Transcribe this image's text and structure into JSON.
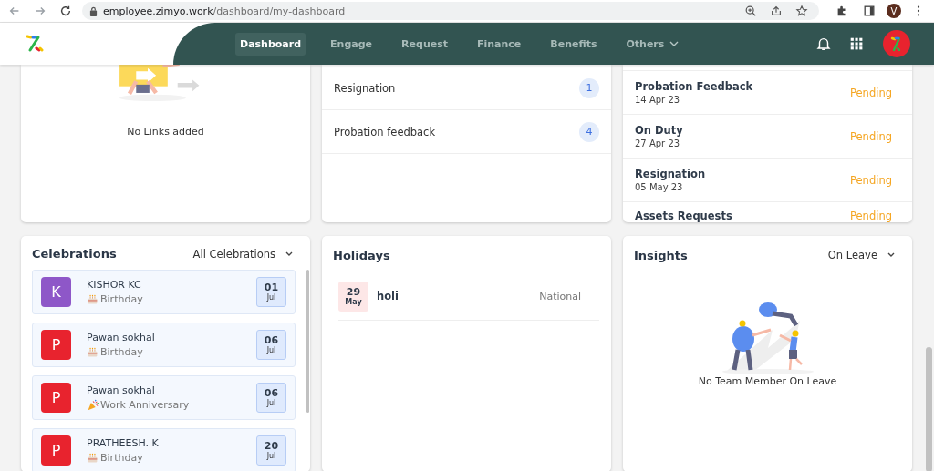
{
  "browser": {
    "url_host": "employee.zimyo.work",
    "url_path": "/dashboard/my-dashboard",
    "profile_initial": "V"
  },
  "nav": {
    "items": [
      {
        "label": "Dashboard",
        "selected": true,
        "dropdown": false
      },
      {
        "label": "Engage",
        "selected": false,
        "dropdown": false
      },
      {
        "label": "Request",
        "selected": false,
        "dropdown": false
      },
      {
        "label": "Finance",
        "selected": false,
        "dropdown": false
      },
      {
        "label": "Benefits",
        "selected": false,
        "dropdown": false
      },
      {
        "label": "Others",
        "selected": false,
        "dropdown": true
      }
    ]
  },
  "links_card": {
    "empty_text": "No Links added"
  },
  "pending_counts": {
    "rows": [
      {
        "label": "Resignation",
        "count": "1"
      },
      {
        "label": "Probation feedback",
        "count": "4"
      }
    ]
  },
  "requests": {
    "rows": [
      {
        "title": "Probation Feedback",
        "date": "14 Apr 23",
        "status": "Pending"
      },
      {
        "title": "On Duty",
        "date": "27 Apr 23",
        "status": "Pending"
      },
      {
        "title": "Resignation",
        "date": "05 May 23",
        "status": "Pending"
      },
      {
        "title": "Assets Requests",
        "status": "Pending"
      }
    ]
  },
  "celebrations": {
    "title": "Celebrations",
    "filter": "All Celebrations",
    "items": [
      {
        "initial": "K",
        "color": "#8e57c8",
        "name": "KISHOR KC",
        "kind": "birthday",
        "occasion": "Birthday",
        "day": "01",
        "month": "Jul"
      },
      {
        "initial": "P",
        "color": "#e8232e",
        "name": "Pawan sokhal",
        "kind": "birthday",
        "occasion": "Birthday",
        "day": "06",
        "month": "Jul"
      },
      {
        "initial": "P",
        "color": "#e8232e",
        "name": "Pawan sokhal",
        "kind": "anniversary",
        "occasion": "Work Anniversary",
        "day": "06",
        "month": "Jul"
      },
      {
        "initial": "P",
        "color": "#e8232e",
        "name": "PRATHEESH. K",
        "kind": "birthday",
        "occasion": "Birthday",
        "day": "20",
        "month": "Jul"
      }
    ]
  },
  "holidays": {
    "title": "Holidays",
    "items": [
      {
        "day": "29",
        "month": "May",
        "name": "holi",
        "type": "National"
      }
    ]
  },
  "insights": {
    "title": "Insights",
    "filter": "On Leave",
    "empty_text": "No Team Member On Leave"
  }
}
